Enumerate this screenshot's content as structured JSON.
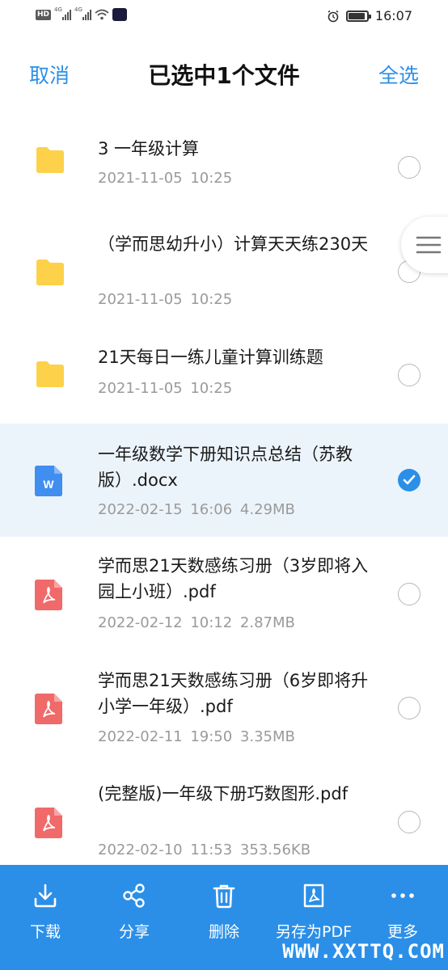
{
  "status_bar": {
    "hd_badge": "HD",
    "sim1_label": "4G",
    "sim2_label": "4G",
    "time": "16:07"
  },
  "header": {
    "cancel_label": "取消",
    "title": "已选中1个文件",
    "select_all_label": "全选"
  },
  "files": [
    {
      "type": "folder",
      "icon": "folder-icon",
      "name": "3 一年级计算",
      "meta": "2021-11-05  10:25",
      "selected": false
    },
    {
      "type": "folder",
      "icon": "folder-icon",
      "name": "（学而思幼升小）计算天天练230天",
      "meta": "2021-11-05  10:25",
      "selected": false
    },
    {
      "type": "folder",
      "icon": "folder-icon",
      "name": "21天每日一练儿童计算训练题",
      "meta": "2021-11-05  10:25",
      "selected": false
    },
    {
      "type": "docx",
      "icon": "word-doc-icon",
      "icon_letter": "W",
      "name": "一年级数学下册知识点总结（苏教版）.docx",
      "meta": "2022-02-15  16:06  4.29MB",
      "selected": true
    },
    {
      "type": "pdf",
      "icon": "pdf-icon",
      "name": "学而思21天数感练习册（3岁即将入园上小班）.pdf",
      "meta": "2022-02-12  10:12  2.87MB",
      "selected": false
    },
    {
      "type": "pdf",
      "icon": "pdf-icon",
      "name": "学而思21天数感练习册（6岁即将升小学一年级）.pdf",
      "meta": "2022-02-11  19:50  3.35MB",
      "selected": false
    },
    {
      "type": "pdf",
      "icon": "pdf-icon",
      "name": "(完整版)一年级下册巧数图形.pdf",
      "meta": "2022-02-10  11:53  353.56KB",
      "selected": false
    }
  ],
  "toolbar": {
    "items": [
      {
        "icon": "download-icon",
        "label": "下载"
      },
      {
        "icon": "share-icon",
        "label": "分享"
      },
      {
        "icon": "trash-icon",
        "label": "删除"
      },
      {
        "icon": "save-as-pdf-icon",
        "label": "另存为PDF"
      },
      {
        "icon": "more-icon",
        "label": "更多"
      }
    ]
  },
  "watermark": "WWW.XXTTQ.COM",
  "colors": {
    "accent": "#2b8fe8",
    "folder": "#fdd24a",
    "word": "#3f8ef0",
    "pdf": "#f06a6a",
    "selected_row": "#ecf4fb",
    "meta_text": "#9a9a9a"
  }
}
